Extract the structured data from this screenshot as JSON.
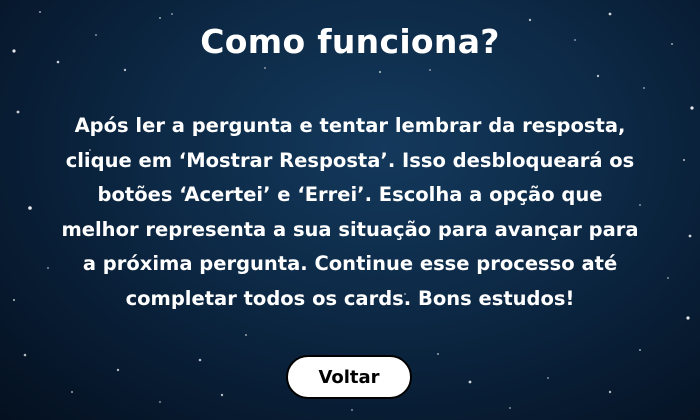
{
  "title": "Como funciona?",
  "instructions": "Após ler a pergunta e tentar lembrar da resposta, clique em ‘Mostrar Resposta’. Isso desbloqueará os botões ‘Acertei’ e ‘Errei’. Escolha a opção que melhor representa a sua situação para avançar para a próxima pergunta. Continue esse processo até completar todos os cards. Bons estudos!",
  "back_button": {
    "label": "Voltar"
  },
  "colors": {
    "background_center": "#14395c",
    "background_edge": "#04101f",
    "text": "#ffffff",
    "button_bg": "#ffffff",
    "button_text": "#000000"
  }
}
